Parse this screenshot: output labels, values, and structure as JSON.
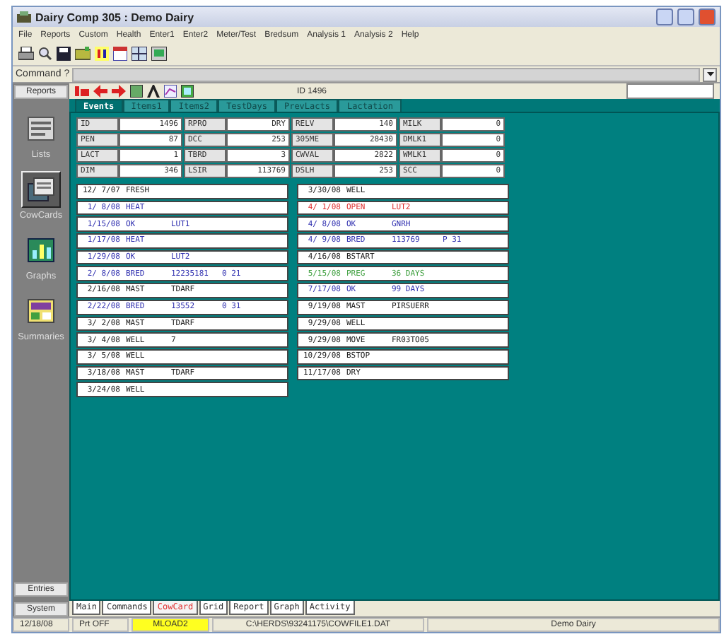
{
  "window": {
    "title": "Dairy Comp 305 : Demo Dairy"
  },
  "menu": [
    "File",
    "Reports",
    "Custom",
    "Health",
    "Enter1",
    "Enter2",
    "Meter/Test",
    "Bredsum",
    "Analysis 1",
    "Analysis 2",
    "Help"
  ],
  "command": {
    "label": "Command ?"
  },
  "sidebar": {
    "items": [
      {
        "label": "Reports",
        "kind": "button"
      },
      {
        "label": "Lists",
        "kind": "icon",
        "selected": false
      },
      {
        "label": "CowCards",
        "kind": "icon",
        "selected": true
      },
      {
        "label": "Graphs",
        "kind": "icon",
        "selected": false
      },
      {
        "label": "Summaries",
        "kind": "icon",
        "selected": false
      }
    ],
    "bottom": [
      "Entries",
      "System"
    ]
  },
  "cow_header": {
    "id": "ID 1496"
  },
  "tabs": [
    {
      "label": "Events",
      "selected": true
    },
    {
      "label": "Items1",
      "selected": false
    },
    {
      "label": "Items2",
      "selected": false
    },
    {
      "label": "TestDays",
      "selected": false
    },
    {
      "label": "PrevLacts",
      "selected": false
    },
    {
      "label": "Lactation",
      "selected": false
    }
  ],
  "fields": [
    [
      {
        "label": "ID",
        "value": "1496"
      },
      {
        "label": "RPRO",
        "value": "DRY"
      },
      {
        "label": "RELV",
        "value": "140"
      },
      {
        "label": "MILK",
        "value": "0"
      }
    ],
    [
      {
        "label": "PEN",
        "value": "87"
      },
      {
        "label": "DCC",
        "value": "253"
      },
      {
        "label": "305ME",
        "value": "28430"
      },
      {
        "label": "DMLK1",
        "value": "0"
      }
    ],
    [
      {
        "label": "LACT",
        "value": "1"
      },
      {
        "label": "TBRD",
        "value": "3"
      },
      {
        "label": "CWVAL",
        "value": "2822"
      },
      {
        "label": "WMLK1",
        "value": "0"
      }
    ],
    [
      {
        "label": "DIM",
        "value": "346"
      },
      {
        "label": "LSIR",
        "value": "113769"
      },
      {
        "label": "DSLH",
        "value": "253"
      },
      {
        "label": "SCC",
        "value": "0"
      }
    ]
  ],
  "events": {
    "left": [
      {
        "date": "12/ 7/07",
        "event": "FRESH",
        "color": "#202020"
      },
      {
        "date": "1/ 8/08",
        "event": "HEAT",
        "color": "#3030b0"
      },
      {
        "date": "1/15/08",
        "event": "OK",
        "remark": "LUT1",
        "color": "#3030b0"
      },
      {
        "date": "1/17/08",
        "event": "HEAT",
        "color": "#3030b0"
      },
      {
        "date": "1/29/08",
        "event": "OK",
        "remark": "LUT2",
        "color": "#3030b0"
      },
      {
        "date": "2/ 8/08",
        "event": "BRED",
        "remark": "12235181",
        "note": "0 21",
        "color": "#3030b0"
      },
      {
        "date": "2/16/08",
        "event": "MAST",
        "remark": "TDARF",
        "color": "#202020"
      },
      {
        "date": "2/22/08",
        "event": "BRED",
        "remark": "13552",
        "note": "0 31",
        "color": "#3030b0"
      },
      {
        "date": "3/ 2/08",
        "event": "MAST",
        "remark": "TDARF",
        "color": "#202020"
      },
      {
        "date": "3/ 4/08",
        "event": "WELL",
        "remark": "7",
        "color": "#202020"
      },
      {
        "date": "3/ 5/08",
        "event": "WELL",
        "color": "#202020"
      },
      {
        "date": "3/18/08",
        "event": "MAST",
        "remark": "TDARF",
        "color": "#202020"
      },
      {
        "date": "3/24/08",
        "event": "WELL",
        "color": "#202020"
      }
    ],
    "right": [
      {
        "date": "3/30/08",
        "event": "WELL",
        "color": "#202020"
      },
      {
        "date": "4/ 1/08",
        "event": "OPEN",
        "remark": "LUT2",
        "color": "#e03030"
      },
      {
        "date": "4/ 8/08",
        "event": "OK",
        "remark": "GNRH",
        "color": "#3030b0"
      },
      {
        "date": "4/ 9/08",
        "event": "BRED",
        "remark": "113769",
        "note": "P 31",
        "color": "#3030b0"
      },
      {
        "date": "4/16/08",
        "event": "BSTART",
        "color": "#202020"
      },
      {
        "date": "5/15/08",
        "event": "PREG",
        "remark": "36 DAYS",
        "color": "#40a040"
      },
      {
        "date": "7/17/08",
        "event": "OK",
        "remark": "99 DAYS",
        "color": "#3030b0"
      },
      {
        "date": "9/19/08",
        "event": "MAST",
        "remark": "PIRSUERR",
        "color": "#202020"
      },
      {
        "date": "9/29/08",
        "event": "WELL",
        "color": "#202020"
      },
      {
        "date": "9/29/08",
        "event": "MOVE",
        "remark": "FR03TO05",
        "color": "#202020"
      },
      {
        "date": "10/29/08",
        "event": "BSTOP",
        "color": "#202020"
      },
      {
        "date": "11/17/08",
        "event": "DRY",
        "color": "#202020"
      }
    ]
  },
  "bottom_tabs": [
    {
      "label": "Main",
      "selected": false
    },
    {
      "label": "Commands",
      "selected": false
    },
    {
      "label": "CowCard",
      "selected": true
    },
    {
      "label": "Grid",
      "selected": false
    },
    {
      "label": "Report",
      "selected": false
    },
    {
      "label": "Graph",
      "selected": false
    },
    {
      "label": "Activity",
      "selected": false
    }
  ],
  "status_bar": [
    {
      "text": "12/18/08",
      "highlight": false
    },
    {
      "text": "Prt OFF",
      "highlight": false
    },
    {
      "text": "MLOAD2",
      "highlight": true
    },
    {
      "text": "C:\\HERDS\\93241175\\COWFILE1.DAT",
      "highlight": false
    },
    {
      "text": "Demo Dairy",
      "highlight": false
    }
  ]
}
